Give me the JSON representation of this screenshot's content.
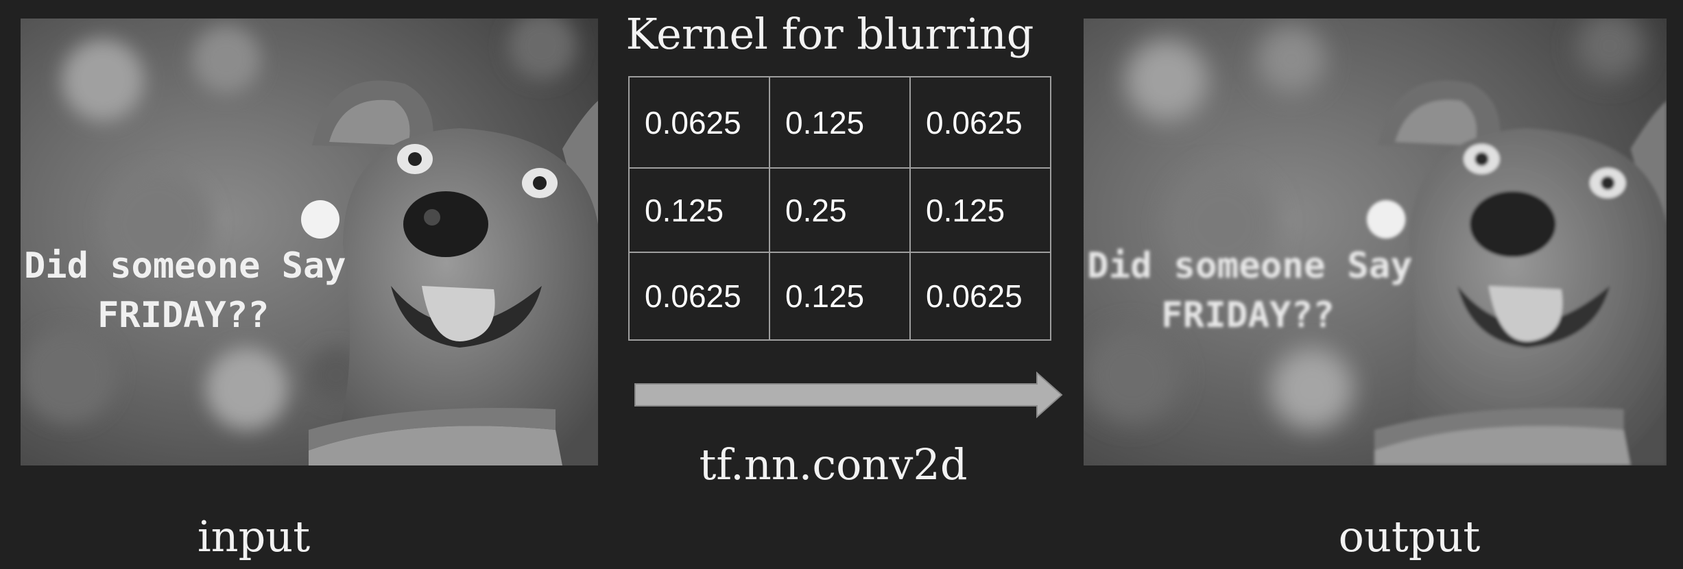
{
  "kernel": {
    "title": "Kernel for blurring",
    "rows": [
      [
        "0.0625",
        "0.125",
        "0.0625"
      ],
      [
        "0.125",
        "0.25",
        "0.125"
      ],
      [
        "0.0625",
        "0.125",
        "0.0625"
      ]
    ]
  },
  "operation": {
    "label": "tf.nn.conv2d"
  },
  "input": {
    "label": "input"
  },
  "output": {
    "label": "output"
  },
  "meme_caption": {
    "line1": "Did someone Say",
    "line2": "FRIDAY??"
  },
  "colors": {
    "background": "#212121",
    "table_border": "#9e9e9e",
    "arrow": "#b0b0b0"
  }
}
